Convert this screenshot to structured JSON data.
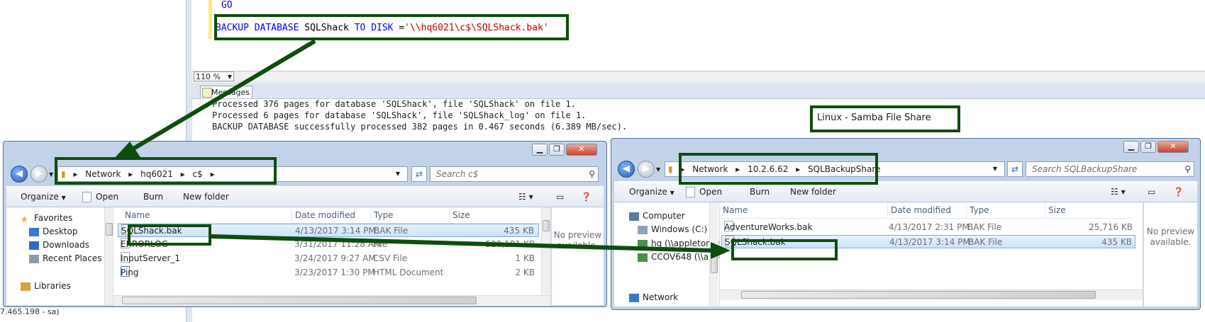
{
  "editor": {
    "go_keyword": "GO",
    "sql_backup": "BACKUP",
    "sql_database": "DATABASE",
    "sql_dbname": "SQLShack",
    "sql_to": "TO",
    "sql_disk": "DISK",
    "sql_eq": "=",
    "sql_path": "'\\\\hq6021\\c$\\SQLShack.bak'",
    "zoom_value": "110 %"
  },
  "messages": {
    "tab_label": "Messages",
    "lines": [
      "Processed 376 pages for database 'SQLShack', file 'SQLShack' on file 1.",
      "Processed 6 pages for database 'SQLShack', file 'SQLShack_log' on file 1.",
      "BACKUP DATABASE successfully processed 382 pages in 0.467 seconds (6.389 MB/sec)."
    ],
    "status_fragment": "7.465.198 - sa)"
  },
  "annotation": {
    "linux_label": "Linux - Samba File Share"
  },
  "left_window": {
    "breadcrumb": [
      "Network",
      "hq6021",
      "c$"
    ],
    "search_placeholder": "Search c$",
    "toolbar": {
      "organize": "Organize",
      "open": "Open",
      "burn": "Burn",
      "new_folder": "New folder"
    },
    "nav": [
      {
        "label": "Favorites",
        "icon": "star-icon"
      },
      {
        "label": "Desktop",
        "icon": "desktop-icon"
      },
      {
        "label": "Downloads",
        "icon": "downloads-icon"
      },
      {
        "label": "Recent Places",
        "icon": "recent-places-icon"
      },
      {
        "label": "Libraries",
        "icon": "libraries-icon"
      }
    ],
    "columns": [
      "Name",
      "Date modified",
      "Type",
      "Size"
    ],
    "files": [
      {
        "name": "SQLShack.bak",
        "date": "4/13/2017 3:14 PM",
        "type": "BAK File",
        "size": "435 KB"
      },
      {
        "name": "ERRORLOG",
        "date": "3/31/2017 11:28 AM",
        "type": "File",
        "size": "520,181 KB"
      },
      {
        "name": "InputServer_1",
        "date": "3/24/2017 9:27 AM",
        "type": "CSV File",
        "size": "1 KB"
      },
      {
        "name": "Ping",
        "date": "3/23/2017 1:30 PM",
        "type": "HTML Document",
        "size": "2 KB"
      }
    ],
    "preview_text": "No preview available."
  },
  "right_window": {
    "breadcrumb": [
      "Network",
      "10.2.6.62",
      "SQLBackupShare"
    ],
    "search_placeholder": "Search SQLBackupShare",
    "toolbar": {
      "organize": "Organize",
      "open": "Open",
      "burn": "Burn",
      "new_folder": "New folder"
    },
    "nav": [
      {
        "label": "Computer",
        "icon": "computer-icon"
      },
      {
        "label": "Windows (C:)",
        "icon": "drive-icon"
      },
      {
        "label": "hq (\\\\appletonpe",
        "icon": "network-drive-icon"
      },
      {
        "label": "CCOV648 (\\\\appl",
        "icon": "network-drive-icon"
      },
      {
        "label": "Network",
        "icon": "network-icon"
      }
    ],
    "columns": [
      "Name",
      "Date modified",
      "Type",
      "Size"
    ],
    "files": [
      {
        "name": "AdventureWorks.bak",
        "date": "4/13/2017 2:31 PM",
        "type": "BAK File",
        "size": "25,716 KB"
      },
      {
        "name": "SQLShack.bak",
        "date": "4/13/2017 3:14 PM",
        "type": "BAK File",
        "size": "435 KB"
      }
    ],
    "preview_text": "No preview available."
  },
  "colors": {
    "annotation_green": "#0d4d0d",
    "sql_keyword": "#0000ff",
    "sql_string": "#c00000"
  }
}
